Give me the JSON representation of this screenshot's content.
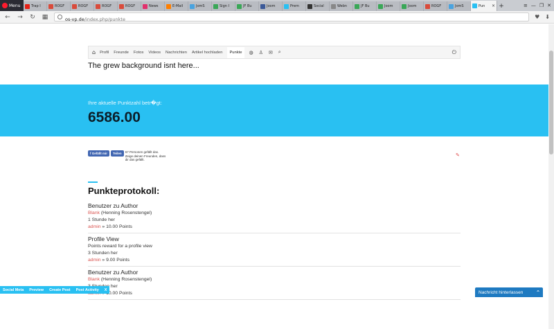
{
  "browser": {
    "menu_label": "Menu",
    "tabs": [
      {
        "label": "Trap I",
        "color": "#e62117"
      },
      {
        "label": "ROGF",
        "color": "#d94b3b"
      },
      {
        "label": "ROGF",
        "color": "#d94b3b"
      },
      {
        "label": "ROGF",
        "color": "#d94b3b"
      },
      {
        "label": "ROGF",
        "color": "#d94b3b"
      },
      {
        "label": "News",
        "color": "#e1306c"
      },
      {
        "label": "E-Mail",
        "color": "#ff7f00"
      },
      {
        "label": "JomS",
        "color": "#4aa3df"
      },
      {
        "label": "Sign I",
        "color": "#3aa757"
      },
      {
        "label": "JF Bu",
        "color": "#3aa757"
      },
      {
        "label": "Joom",
        "color": "#3b5998"
      },
      {
        "label": "Prem",
        "color": "#29c0f2"
      },
      {
        "label": "Social",
        "color": "#333333"
      },
      {
        "label": "Webn",
        "color": "#888888"
      },
      {
        "label": "JF Bu",
        "color": "#3aa757"
      },
      {
        "label": "Joom",
        "color": "#3aa757"
      },
      {
        "label": "Joom",
        "color": "#3aa757"
      },
      {
        "label": "ROGF",
        "color": "#d94b3b"
      },
      {
        "label": "JomS",
        "color": "#4aa3df"
      }
    ],
    "active_tab": {
      "label": "Pun",
      "close": "×",
      "color": "#29c0f2"
    },
    "new_tab": "+",
    "url_host": "os-vp.de",
    "url_path": "/index.php/punkte"
  },
  "toolbar": {
    "items": [
      "Profil",
      "Freunde",
      "Fotos",
      "Videos",
      "Nachrichten",
      "Artikel hochladen",
      "Punkte"
    ]
  },
  "note": "The grew background isnt here...",
  "banner": {
    "label": "Ihre aktuelle Punktzahl betr�gt:",
    "points": "6586.00"
  },
  "facebook": {
    "like": "Gefällt mir",
    "share": "Teilen",
    "text": "67 Personen gefällt das. Zeige deinen Freunden, dass dir das gefällt."
  },
  "section_title": "Punkteprotokoll:",
  "entries": [
    {
      "title": "Benutzer zu Author",
      "user": "Blank",
      "user_rest": " (Henning Rosenstengel)",
      "time": "1 Stunde her",
      "admin": "admin",
      "points": " » 10.00 Points"
    },
    {
      "title": "Profile View",
      "desc": "Points reward for a profile view",
      "time": "3 Stunden her",
      "admin": "admin",
      "points": " » 9.00 Points"
    },
    {
      "title": "Benutzer zu Author",
      "user": "Blank",
      "user_rest": " (Henning Rosenstengel)",
      "time": "3 Stunden her",
      "admin": "admin",
      "points": " » 10.00 Points"
    }
  ],
  "social_bar": [
    "Social Meta",
    "Preview",
    "Create Post",
    "Post Activity",
    "X"
  ],
  "leave_message": {
    "label": "Nachricht hinterlassen",
    "chevron": "⌃"
  }
}
